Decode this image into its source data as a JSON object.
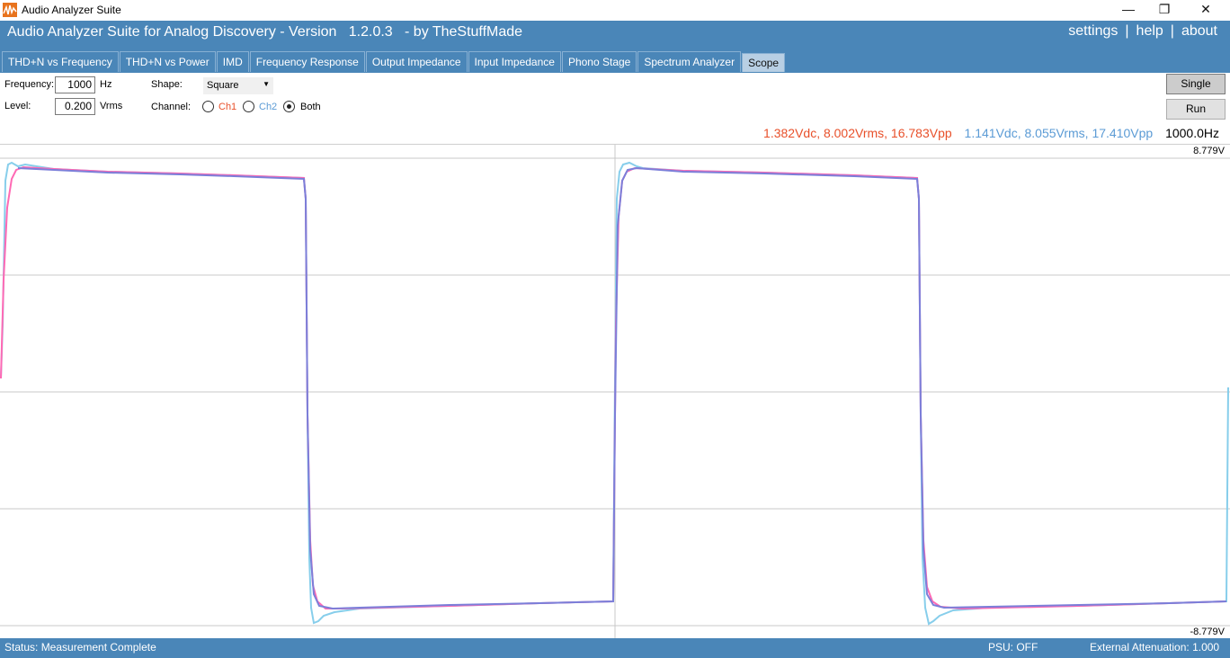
{
  "window": {
    "title": "Audio Analyzer Suite",
    "controls": {
      "minimize": "—",
      "restore": "❐",
      "close": "✕"
    }
  },
  "header": {
    "title": "Audio Analyzer Suite for Analog Discovery - Version   1.2.0.3   - by TheStuffMade",
    "links": [
      "settings",
      "help",
      "about"
    ],
    "separator": "|"
  },
  "tabs": [
    {
      "label": "THD+N vs Frequency",
      "active": false
    },
    {
      "label": "THD+N vs Power",
      "active": false
    },
    {
      "label": "IMD",
      "active": false
    },
    {
      "label": "Frequency Response",
      "active": false
    },
    {
      "label": "Output Impedance",
      "active": false
    },
    {
      "label": "Input Impedance",
      "active": false
    },
    {
      "label": "Phono Stage",
      "active": false
    },
    {
      "label": "Spectrum Analyzer",
      "active": false
    },
    {
      "label": "Scope",
      "active": true
    }
  ],
  "controls": {
    "frequency": {
      "label": "Frequency:",
      "value": "1000",
      "unit": "Hz"
    },
    "level": {
      "label": "Level:",
      "value": "0.200",
      "unit": "Vrms"
    },
    "shape": {
      "label": "Shape:",
      "value": "Square"
    },
    "channel": {
      "label": "Channel:",
      "options": [
        {
          "label": "Ch1",
          "checked": false,
          "color": "#e8502a"
        },
        {
          "label": "Ch2",
          "checked": false,
          "color": "#5b9bd5"
        },
        {
          "label": "Both",
          "checked": true,
          "color": "#000000"
        }
      ]
    },
    "single_label": "Single",
    "run_label": "Run"
  },
  "measurements": {
    "ch1": "1.382Vdc, 8.002Vrms, 16.783Vpp",
    "ch2": "1.141Vdc, 8.055Vrms, 17.410Vpp",
    "frequency": "1000.0Hz",
    "ch1_color": "#e8502a",
    "ch2_color": "#5b9bd5"
  },
  "scope": {
    "top_label": "8.779V",
    "bottom_label": "-8.779V",
    "trace_colors": {
      "ch1": "#ff69b4",
      "ch2": "#87ceeb",
      "overlap": "#7b7fd9"
    }
  },
  "status": {
    "message": "Status: Measurement Complete",
    "psu": "PSU: OFF",
    "attenuation": "External Attenuation: 1.000"
  }
}
